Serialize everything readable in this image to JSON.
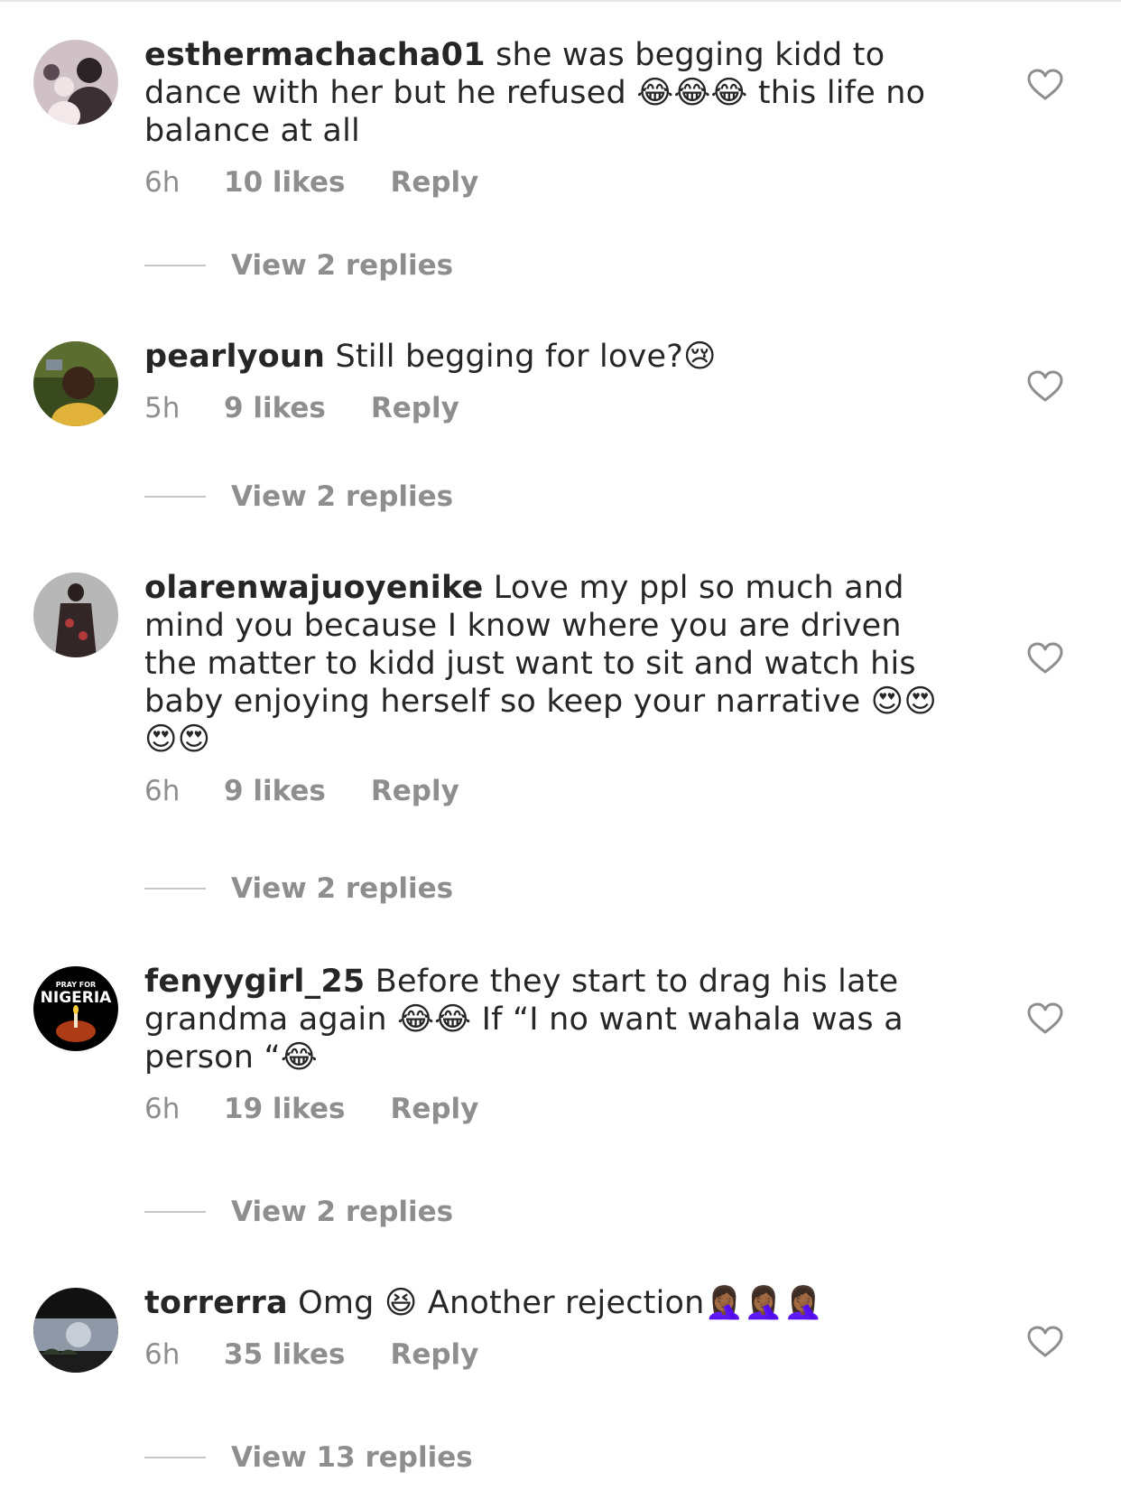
{
  "comments": [
    {
      "username": "esthermachacha01",
      "text": "she was begging kidd to dance with her but he refused 😂😂😂 this life no balance at all",
      "time": "6h",
      "likes": "10 likes",
      "reply": "Reply",
      "view_replies": "View 2 replies",
      "avatar_colors": [
        "#6b5a63",
        "#d9c7cc"
      ]
    },
    {
      "username": "pearlyoun",
      "text": "Still begging for love?😢",
      "time": "5h",
      "likes": "9 likes",
      "reply": "Reply",
      "view_replies": "View 2 replies",
      "avatar_colors": [
        "#3a4a1f",
        "#d6a530"
      ]
    },
    {
      "username": "olarenwajuoyenike",
      "text": "Love my ppl so much and mind you because I know where you are driven the matter to kidd just want to sit and watch his baby enjoying herself so keep your narrative 😍😍😍😍",
      "time": "6h",
      "likes": "9 likes",
      "reply": "Reply",
      "view_replies": "View 2 replies",
      "avatar_colors": [
        "#b8b8b8",
        "#3a2d2d"
      ]
    },
    {
      "username": "fenyygirl_25",
      "text": "Before they start to drag his late grandma again 😂😂 If “I no want wahala was a person “😂",
      "time": "6h",
      "likes": "19 likes",
      "reply": "Reply",
      "view_replies": "View 2 replies",
      "avatar_colors": [
        "#000000",
        "#d84a1b"
      ],
      "avatar_text_small": "PRAY FOR",
      "avatar_text_big": "NIGERIA"
    },
    {
      "username": "torrerra",
      "text": "Omg 😆 Another rejection🤦🏾‍♀️🤦🏾‍♀️🤦🏾‍♀️",
      "time": "6h",
      "likes": "35 likes",
      "reply": "Reply",
      "view_replies": "View 13 replies",
      "avatar_colors": [
        "#111111",
        "#8f98a6"
      ]
    }
  ],
  "icons": {
    "heart": "heart-outline-icon",
    "stroke_color": "#8e8e8e"
  }
}
